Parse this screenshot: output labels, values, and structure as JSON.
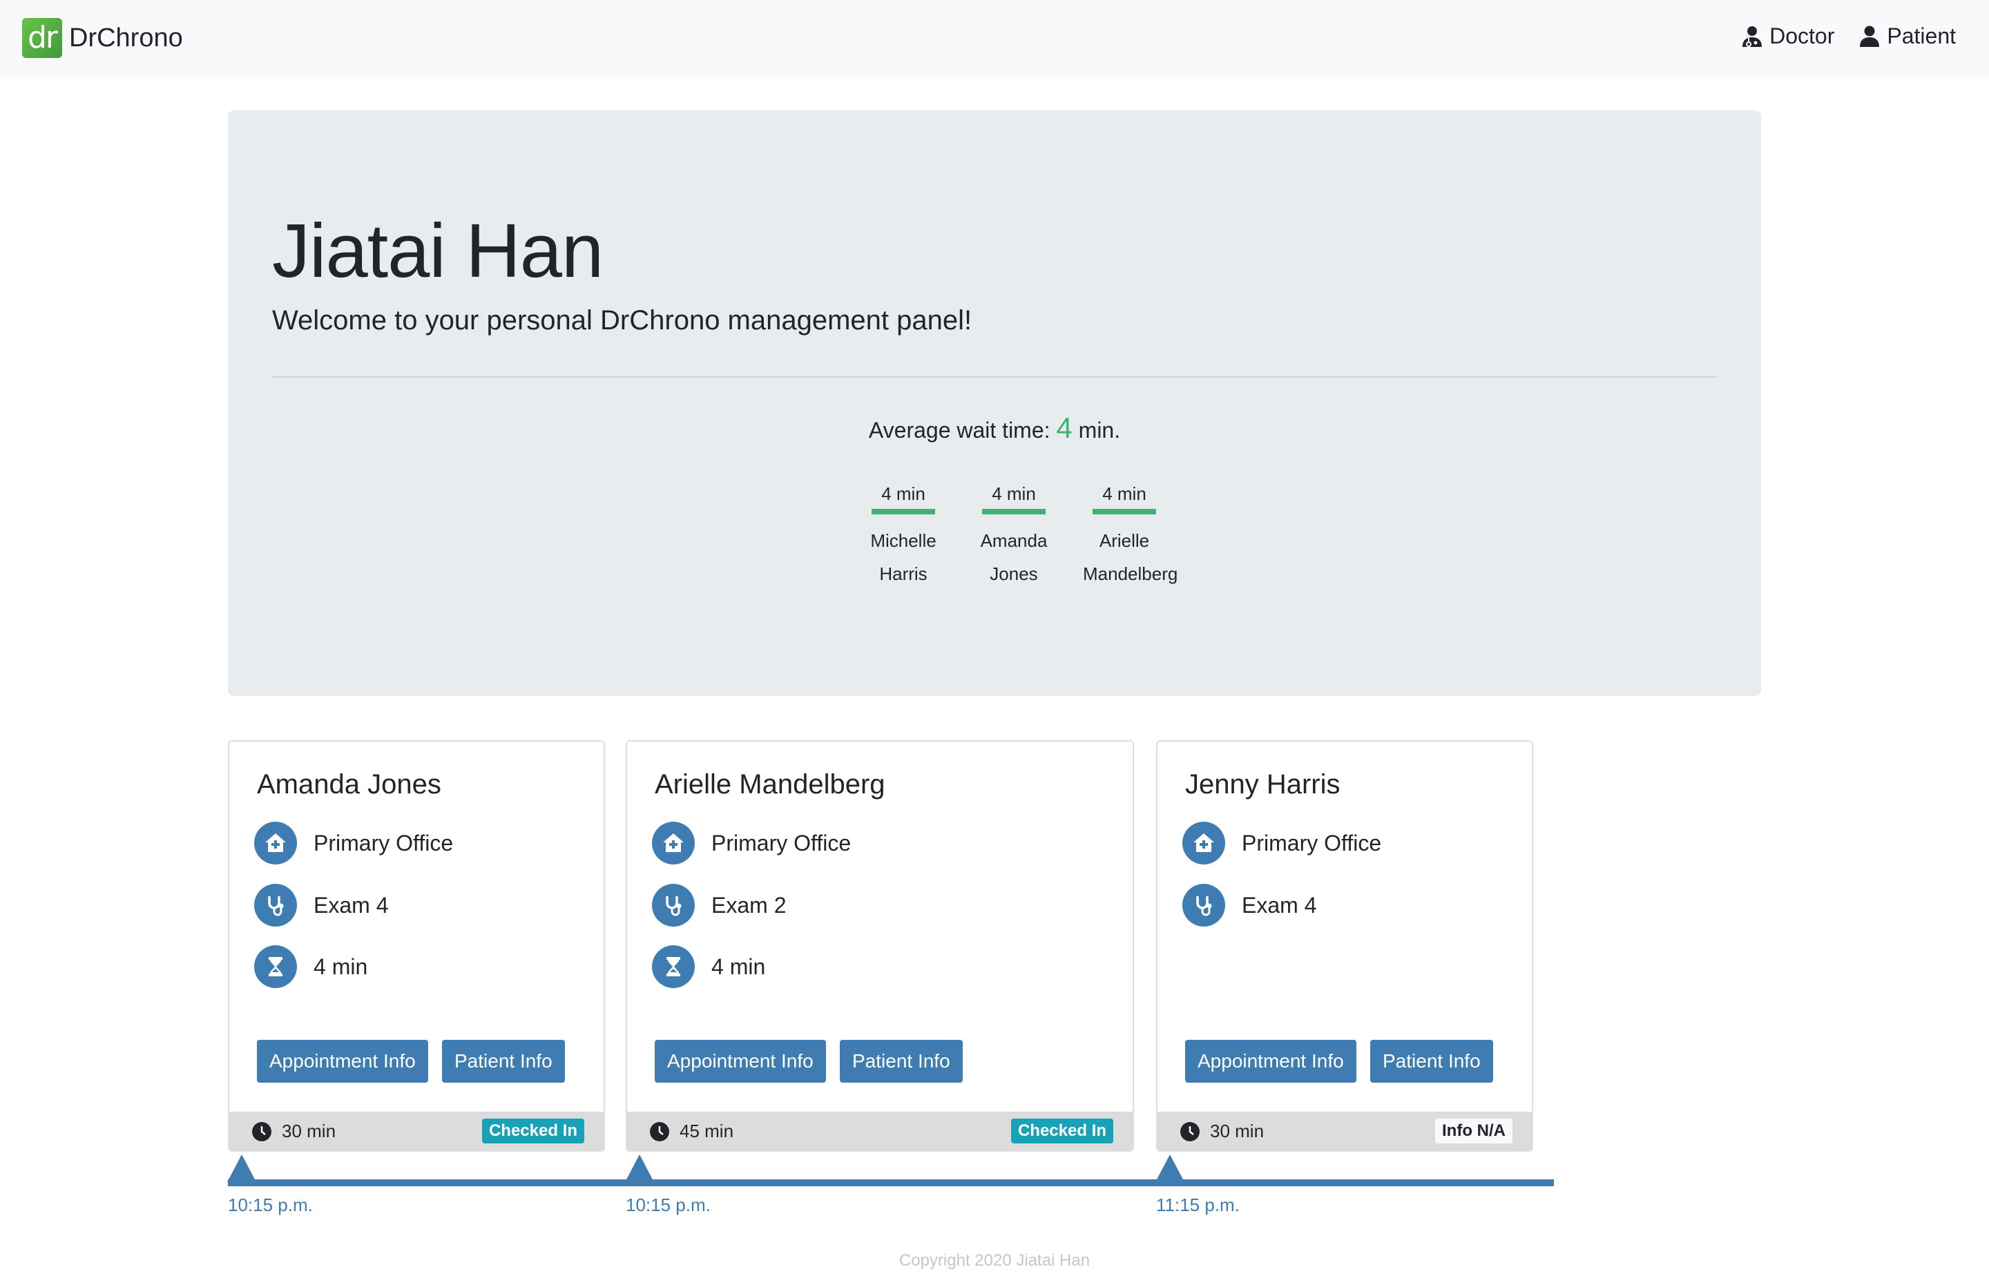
{
  "navbar": {
    "logo_text": "dr",
    "brand": "DrChrono",
    "links": [
      {
        "label": "Doctor",
        "icon": "doctor-icon"
      },
      {
        "label": "Patient",
        "icon": "user-icon"
      }
    ]
  },
  "jumbotron": {
    "title": "Jiatai Han",
    "lead": "Welcome to your personal DrChrono management panel!",
    "avg_prefix": "Average wait time:",
    "avg_value": "4",
    "avg_suffix": "min.",
    "waits": [
      {
        "time": "4 min",
        "first": "Michelle",
        "last": "Harris"
      },
      {
        "time": "4 min",
        "first": "Amanda",
        "last": "Jones"
      },
      {
        "time": "4 min",
        "first": "Arielle",
        "last": "Mandelberg"
      }
    ]
  },
  "cards": [
    {
      "name": "Amanda Jones",
      "office": "Primary Office",
      "exam": "Exam 4",
      "wait": "4 min",
      "appointment_button": "Appointment Info",
      "patient_button": "Patient Info",
      "duration": "30 min",
      "status": "Checked In"
    },
    {
      "name": "Arielle Mandelberg",
      "office": "Primary Office",
      "exam": "Exam 2",
      "wait": "4 min",
      "appointment_button": "Appointment Info",
      "patient_button": "Patient Info",
      "duration": "45 min",
      "status": "Checked In"
    },
    {
      "name": "Jenny Harris",
      "office": "Primary Office",
      "exam": "Exam 4",
      "appointment_button": "Appointment Info",
      "patient_button": "Patient Info",
      "duration": "30 min",
      "status": "Info N/A"
    }
  ],
  "timeline": {
    "labels": [
      "10:15 p.m.",
      "10:15 p.m.",
      "11:15 p.m."
    ]
  },
  "footer": {
    "copyright": "Copyright 2020 Jiatai Han"
  },
  "colors": {
    "accent_blue": "#3e7cb1",
    "wait_green": "#3cb371",
    "badge_teal": "#17a2b8",
    "jumbotron_bg": "#e9ecef"
  }
}
